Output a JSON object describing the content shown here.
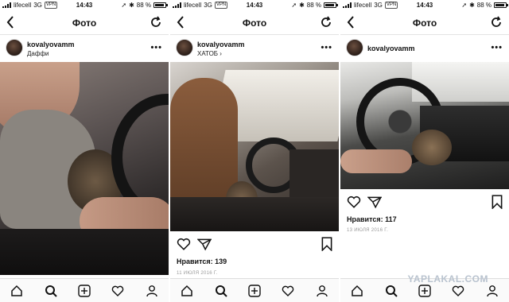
{
  "status_bar": {
    "carrier": "lifecell",
    "network": "3G",
    "vpn": "VPN",
    "time": "14:43",
    "battery_pct": "88 %"
  },
  "nav": {
    "title": "Фото"
  },
  "posts": [
    {
      "username": "kovalyovamm",
      "location": "Даффи",
      "photo_icon": "photo-car-driver-dog"
    },
    {
      "username": "kovalyovamm",
      "location": "ХАТОБ",
      "location_chevron": "›",
      "likes": "Нравится: 139",
      "date": "11 ИЮЛЯ 2016 Г.",
      "photo_icon": "photo-car-interior"
    },
    {
      "username": "kovalyovamm",
      "location": "",
      "likes": "Нравится: 117",
      "date": "13 ИЮЛЯ 2016 Г.",
      "photo_icon": "photo-steering-wheel"
    }
  ],
  "more_glyph": "•••",
  "watermark": "YAPLAKAL.COM",
  "colors": {
    "text": "#111111",
    "muted": "#9a9a9a",
    "watermark": "#b9c3cf"
  }
}
